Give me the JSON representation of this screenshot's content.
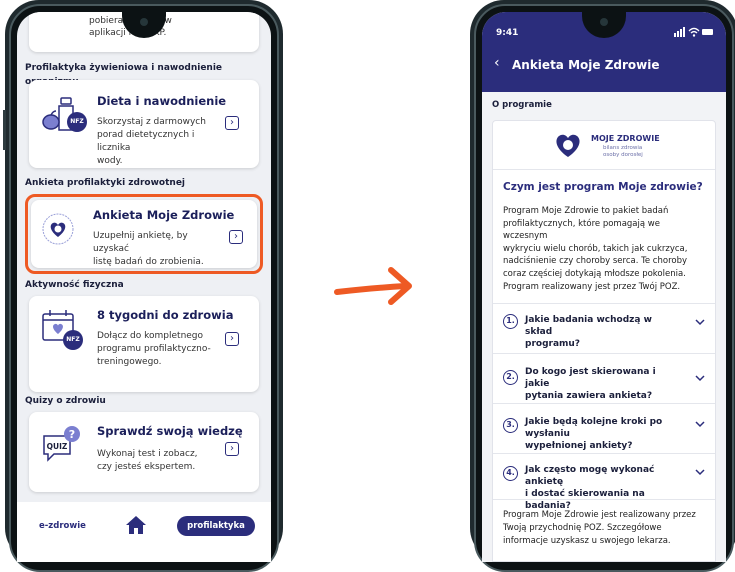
{
  "left_phone": {
    "top_fragment": [
      "pobieran     y krokow",
      "aplikacji mojeIKP."
    ],
    "sections": [
      {
        "title": "Profilaktyka żywieniowa i nawodnienie organizmu"
      },
      {
        "title": "Ankieta profilaktyki zdrowotnej"
      },
      {
        "title": "Aktywność fizyczna"
      },
      {
        "title": "Quizy o zdrowiu"
      }
    ],
    "cards": [
      {
        "title": "Dieta i nawodnienie",
        "desc": [
          "Skorzystaj z darmowych",
          "porad dietetycznych i licznika",
          "wody."
        ],
        "icon": "diet-bottle-icon",
        "badge": "NFZ"
      },
      {
        "title": "Ankieta Moje Zdrowie",
        "desc": [
          "Uzupełnij ankietę, by uzyskać",
          "listę badań do zrobienia."
        ],
        "icon": "moje-zdrowie-logo-icon"
      },
      {
        "title": "8 tygodni do zdrowia",
        "desc": [
          "Dołącz do kompletnego",
          "programu profilaktyczno-",
          "treningowego."
        ],
        "icon": "calendar-icon",
        "badge": "NFZ"
      },
      {
        "title": "Sprawdź swoją wiedzę",
        "desc": [
          "Wykonaj test i zobacz,",
          "czy jesteś ekspertem."
        ],
        "icon": "quiz-bubble-icon",
        "icon_label": "QUIZ"
      }
    ],
    "bottom_nav": {
      "left": "e-zdrowie",
      "home_icon": "home-icon",
      "right": "profilaktyka"
    },
    "highlight_color": "#ee5a24"
  },
  "arrow": {
    "icon": "right-arrow-icon",
    "color": "#ee5a24"
  },
  "right_phone": {
    "status_time": "9:41",
    "header_title": "Ankieta Moje Zdrowie",
    "section_label": "O programie",
    "logo": {
      "title": "MOJE ZDROWIE",
      "subtitle_1": "bilans zdrowia",
      "subtitle_2": "osoby dorosłej"
    },
    "card_title": "Czym jest program Moje zdrowie?",
    "card_body": [
      "Program Moje Zdrowie to pakiet badań",
      "profilaktycznych, które pomagają we wczesnym",
      "wykryciu wielu chorób, takich jak cukrzyca,",
      "nadciśnienie czy choroby serca. Te choroby",
      "coraz częściej dotykają młodsze pokolenia.",
      "Program realizowany jest przez Twój POZ."
    ],
    "accordion": [
      {
        "num": "1.",
        "lines": [
          "Jakie badania wchodzą w skład",
          "programu?"
        ]
      },
      {
        "num": "2.",
        "lines": [
          "Do kogo jest skierowana i jakie",
          "pytania zawiera ankieta?"
        ]
      },
      {
        "num": "3.",
        "lines": [
          "Jakie będą kolejne kroki po wysłaniu",
          "wypełnionej ankiety?"
        ]
      },
      {
        "num": "4.",
        "lines": [
          "Jak często mogę wykonać ankietę",
          "i dostać skierowania na badania?"
        ]
      }
    ],
    "footer_text": [
      "Program Moje Zdrowie jest realizowany przez",
      "Twoją przychodnię POZ. Szczegółowe",
      "informacje uzyskasz u swojego lekarza."
    ],
    "primary_color": "#2b2d7c"
  }
}
